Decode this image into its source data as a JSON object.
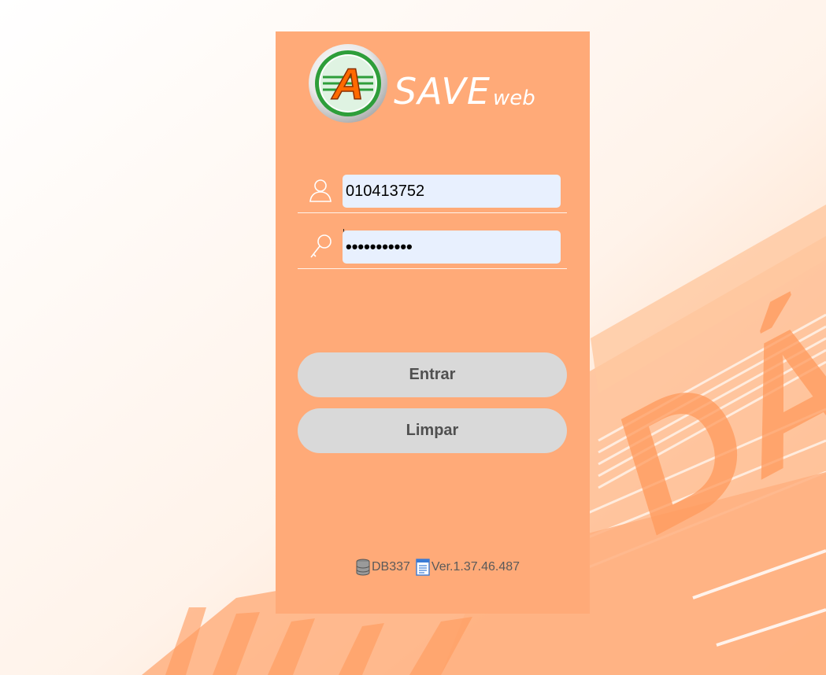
{
  "logo": {
    "letter": "A",
    "text_main": "SAVE",
    "text_sub": "web"
  },
  "login": {
    "user_value": "010413752",
    "password_mask": "•••••••••••"
  },
  "buttons": {
    "entrar": "Entrar",
    "limpar": "Limpar"
  },
  "footer": {
    "db": "DB337",
    "version": "Ver.1.37.46.487"
  },
  "background": {
    "letters": "DÁ"
  },
  "icons": {
    "user": "user-icon",
    "password": "key-icon",
    "db": "database-icon",
    "version": "document-icon"
  },
  "colors": {
    "panel": "#ffaa78",
    "input": "#e8f0fe",
    "button": "#d9d9d9",
    "button_text": "#505050",
    "logo_green": "#2e9e3a",
    "logo_orange": "#ff6a00"
  }
}
